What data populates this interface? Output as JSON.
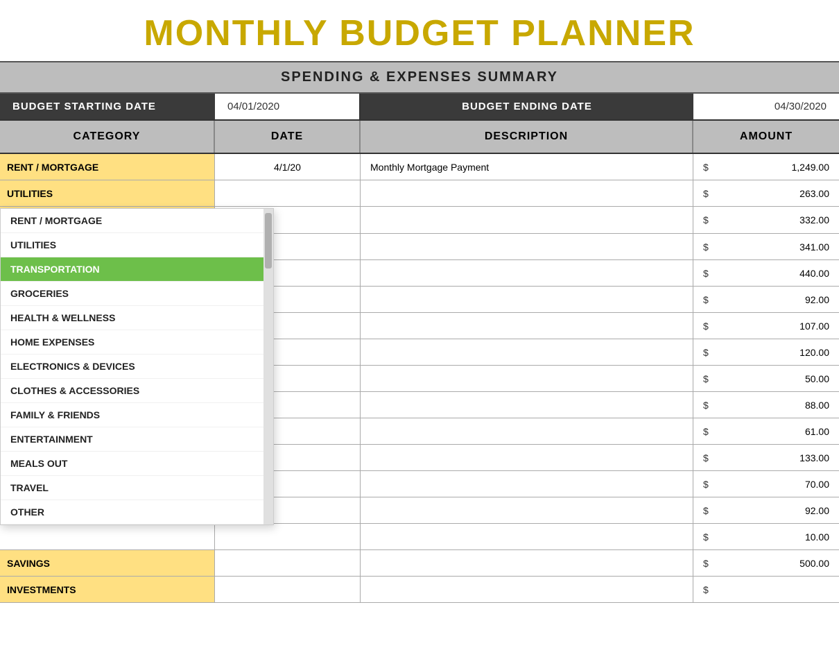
{
  "title": "MONTHLY BUDGET PLANNER",
  "subtitle": "SPENDING & EXPENSES SUMMARY",
  "budget_start_label": "BUDGET STARTING DATE",
  "budget_start_value": "04/01/2020",
  "budget_end_label": "BUDGET ENDING DATE",
  "budget_end_value": "04/30/2020",
  "table_headers": {
    "category": "CATEGORY",
    "date": "DATE",
    "description": "DESCRIPTION",
    "amount": "AMOUNT"
  },
  "rows": [
    {
      "category": "RENT / MORTGAGE",
      "yellow": true,
      "date": "4/1/20",
      "description": "Monthly Mortgage Payment",
      "dollar": "$",
      "amount": "1,249.00"
    },
    {
      "category": "UTILITIES",
      "yellow": true,
      "date": "",
      "description": "",
      "dollar": "$",
      "amount": "263.00"
    },
    {
      "category": "TRANSPORTATION",
      "yellow": true,
      "has_dropdown": true,
      "date": "",
      "description": "",
      "dollar": "$",
      "amount": "332.00"
    },
    {
      "category": "",
      "yellow": false,
      "date": "",
      "description": "",
      "dollar": "$",
      "amount": "341.00"
    },
    {
      "category": "",
      "yellow": false,
      "date": "",
      "description": "",
      "dollar": "$",
      "amount": "440.00"
    },
    {
      "category": "",
      "yellow": false,
      "date": "",
      "description": "",
      "dollar": "$",
      "amount": "92.00"
    },
    {
      "category": "",
      "yellow": false,
      "date": "",
      "description": "",
      "dollar": "$",
      "amount": "107.00"
    },
    {
      "category": "",
      "yellow": false,
      "date": "",
      "description": "",
      "dollar": "$",
      "amount": "120.00"
    },
    {
      "category": "",
      "yellow": false,
      "date": "",
      "description": "",
      "dollar": "$",
      "amount": "50.00"
    },
    {
      "category": "",
      "yellow": false,
      "date": "",
      "description": "",
      "dollar": "$",
      "amount": "88.00"
    },
    {
      "category": "",
      "yellow": false,
      "date": "",
      "description": "",
      "dollar": "$",
      "amount": "61.00"
    },
    {
      "category": "",
      "yellow": false,
      "date": "",
      "description": "",
      "dollar": "$",
      "amount": "133.00"
    },
    {
      "category": "",
      "yellow": false,
      "date": "",
      "description": "",
      "dollar": "$",
      "amount": "70.00"
    },
    {
      "category": "",
      "yellow": false,
      "date": "",
      "description": "",
      "dollar": "$",
      "amount": "92.00"
    },
    {
      "category": "",
      "yellow": false,
      "date": "",
      "description": "",
      "dollar": "$",
      "amount": "10.00"
    },
    {
      "category": "SAVINGS",
      "yellow": true,
      "date": "",
      "description": "",
      "dollar": "$",
      "amount": "500.00"
    },
    {
      "category": "INVESTMENTS",
      "yellow": true,
      "date": "",
      "description": "",
      "dollar": "$",
      "amount": ""
    }
  ],
  "dropdown": {
    "items": [
      "RENT / MORTGAGE",
      "UTILITIES",
      "TRANSPORTATION",
      "GROCERIES",
      "HEALTH & WELLNESS",
      "HOME EXPENSES",
      "ELECTRONICS & DEVICES",
      "CLOTHES & ACCESSORIES",
      "FAMILY & FRIENDS",
      "ENTERTAINMENT",
      "MEALS OUT",
      "TRAVEL",
      "OTHER"
    ],
    "selected": "TRANSPORTATION"
  }
}
